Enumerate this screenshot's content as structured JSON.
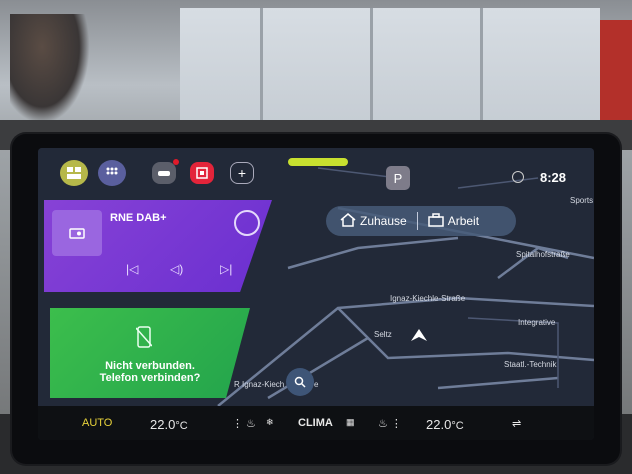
{
  "status": {
    "clock": "8:28"
  },
  "media": {
    "station": "RNE DAB+"
  },
  "phone": {
    "line1": "Nicht verbunden.",
    "line2": "Telefon verbinden?"
  },
  "destinations": {
    "home": "Zuhause",
    "work": "Arbeit"
  },
  "map": {
    "parking_label": "P",
    "streets": [
      "Spitalhofstraße",
      "Ignaz-Kiechle-Straße",
      "Integrative",
      "Staatl.-Technik",
      "Seltz",
      "Sports",
      "R Ignaz-Kiech",
      "e"
    ]
  },
  "climate": {
    "left_mode": "AUTO",
    "left_temp": "22.0",
    "left_unit": "°C",
    "center_label": "CLIMA",
    "right_temp": "22.0",
    "right_unit": "°C"
  },
  "colors": {
    "media_card": "#7b3fd6",
    "phone_card": "#2fb24c",
    "accent": "#c8e02f"
  }
}
